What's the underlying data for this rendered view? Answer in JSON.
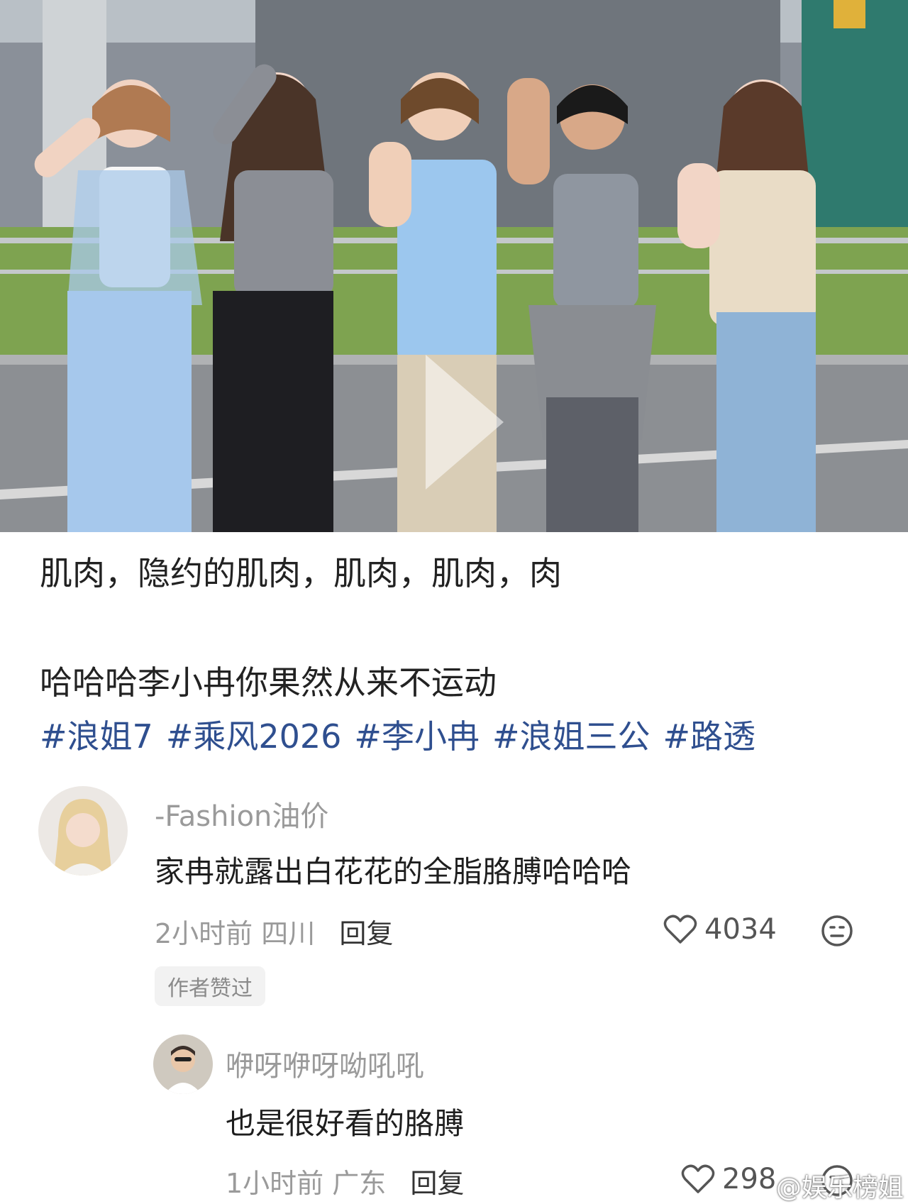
{
  "post": {
    "line1": "肌肉，隐约的肌肉，肌肉，肌肉，肉",
    "line2": "哈哈哈李小冉你果然从来不运动",
    "tags": [
      "#浪姐7",
      "#乘风2026",
      "#李小冉",
      "#浪姐三公",
      "#路透"
    ]
  },
  "comments": [
    {
      "username": "-Fashion油价",
      "text": "家冉就露出白花花的全脂胳膊哈哈哈",
      "time": "2小时前",
      "location": "四川",
      "reply_label": "回复",
      "likes": "4034",
      "badge": "作者赞过",
      "avatar_icon": "user-avatar"
    },
    {
      "username": "咿呀咿呀呦吼吼",
      "text": "也是很好看的胳膊",
      "time": "1小时前",
      "location": "广东",
      "reply_label": "回复",
      "likes": "298",
      "avatar_icon": "user-avatar"
    }
  ],
  "watermark": "@娱乐榜姐",
  "colors": {
    "tag": "#2f4f8f",
    "meta": "#9a9a9a",
    "badge_bg": "#f2f2f2"
  }
}
